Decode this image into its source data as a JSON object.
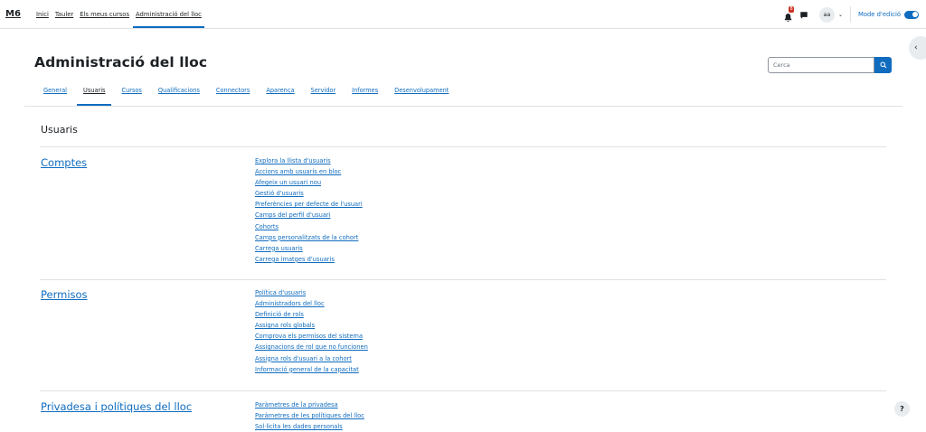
{
  "brand": "M6",
  "primary_nav": [
    {
      "label": "Inici",
      "active": false
    },
    {
      "label": "Tauler",
      "active": false
    },
    {
      "label": "Els meus cursos",
      "active": false
    },
    {
      "label": "Administració del lloc",
      "active": true
    }
  ],
  "navbar": {
    "notification_count": "8",
    "avatar_initials": "aa",
    "edit_mode_label": "Mode d'edició",
    "edit_mode_on": true
  },
  "page": {
    "title": "Administració del lloc",
    "search_placeholder": "Cerca"
  },
  "tabs": [
    {
      "label": "General",
      "active": false
    },
    {
      "label": "Usuaris",
      "active": true
    },
    {
      "label": "Cursos",
      "active": false
    },
    {
      "label": "Qualificacions",
      "active": false
    },
    {
      "label": "Connectors",
      "active": false
    },
    {
      "label": "Aparença",
      "active": false
    },
    {
      "label": "Servidor",
      "active": false
    },
    {
      "label": "Informes",
      "active": false
    },
    {
      "label": "Desenvolupament",
      "active": false
    }
  ],
  "section_heading": "Usuaris",
  "categories": [
    {
      "title": "Comptes",
      "links": [
        "Explora la llista d'usuaris",
        "Accions amb usuaris en bloc",
        "Afegeix un usuari nou",
        "Gestió d'usuaris",
        "Preferències per defecte de l'usuari",
        "Camps del perfil d'usuari",
        "Cohorts",
        "Camps personalitzats de la cohort",
        "Carrega usuaris",
        "Carrega imatges d'usuaris"
      ]
    },
    {
      "title": "Permisos",
      "links": [
        "Política d'usuaris",
        "Administradors del lloc",
        "Definició de rols",
        "Assigna rols globals",
        "Comprova els permisos del sistema",
        "Assignacions de rol que no funcionen",
        "Assigna rols d'usuari a la cohort",
        "Informació general de la capacitat"
      ]
    },
    {
      "title": "Privadesa i polítiques del lloc",
      "links": [
        "Paràmetres de la privadesa",
        "Paràmetres de les polítiques del lloc",
        "Sol·licita les dades personals"
      ]
    }
  ],
  "help_label": "?",
  "colors": {
    "accent": "#0f6cbf",
    "badge": "#ca3120",
    "text": "#1d2125",
    "border": "#dee2e6"
  }
}
